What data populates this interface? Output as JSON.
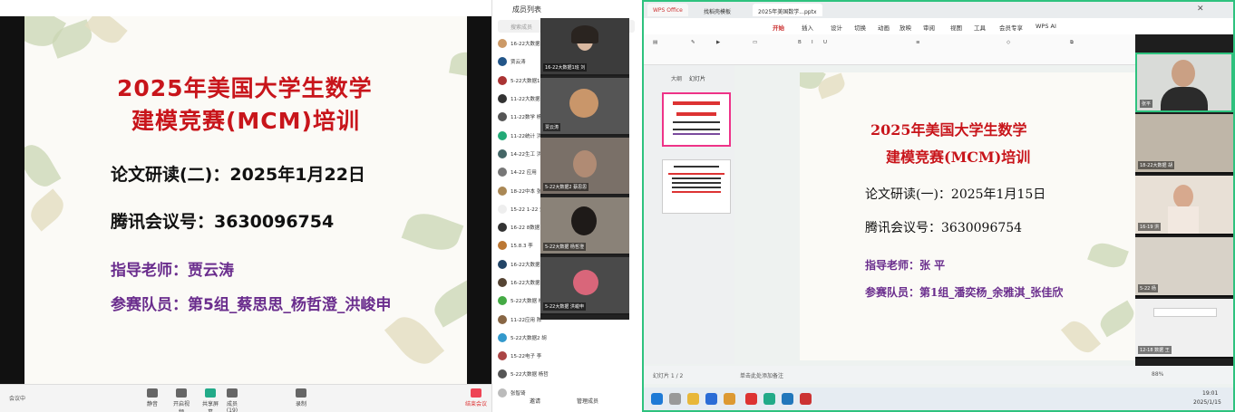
{
  "left_slide": {
    "title1": "2025年美国大学生数学",
    "title2": "建模竞赛(MCM)培训",
    "line1": "论文研读(二)：2025年1月22日",
    "line2": "腾讯会议号：3630096754",
    "line3": "指导老师：贾云涛",
    "line4": "参赛队员：第5组_蔡思思_杨哲澄_洪峻申"
  },
  "left_toolbar": {
    "mic_label": "静音",
    "video_label": "开启视频",
    "share_label": "共享屏幕",
    "members_label": "成员(19)",
    "record_label": "录制",
    "end_label": "结束会议",
    "left_status": "会议中"
  },
  "participants_panel": {
    "title": "成员列表",
    "search_placeholder": "搜索成员",
    "rows": [
      "16-22大数据1班 刘",
      "贾云涛",
      "5-22大数据1 蔡思思",
      "11-22大数据 杨",
      "11-22数学 杨",
      "11-22统计 洪",
      "14-22生工 洪峻申",
      "14-22 应用",
      "18-22中本 张",
      "15-22 1-22 刘",
      "16-22 8数据",
      "15.8.3 李",
      "16-22大数据 王",
      "16-22大数据 胡",
      "5-22大数据 杨",
      "11-22应用 陈",
      "5-22大数据2 胡",
      "15-22电子 李",
      "5-22大数据 杨哲",
      "张智琦"
    ],
    "video_names": [
      "16-22大数据1班 刘",
      "贾云涛",
      "5-22大数据2 蔡思思",
      "5-22大数据 杨哲澄",
      "5-22大数据 洪峻申"
    ],
    "footer_left": "邀请",
    "footer_right": "管理成员"
  },
  "right_window": {
    "tabs": [
      "WPS Office",
      "找稻壳模板",
      "2025年美国数学...pptx"
    ],
    "menus": [
      "开始",
      "插入",
      "设计",
      "切换",
      "动画",
      "放映",
      "审阅",
      "视图",
      "工具",
      "会员专享",
      "WPS AI"
    ],
    "thumb_tab1": "大纲",
    "thumb_tab2": "幻灯片",
    "status_left": "幻灯片 1 / 2",
    "status_mid": "单击此处添加备注",
    "status_right": "88%",
    "video_names": [
      "张平",
      "18-22大数据 胡",
      "16-19 洪",
      "5-22 杨",
      "12-18 数据 王"
    ],
    "time": "19:01",
    "date": "2025/1/15"
  },
  "right_slide": {
    "title1": "2025年美国大学生数学",
    "title2": "建模竞赛(MCM)培训",
    "line1": "论文研读(一)：2025年1月15日",
    "line2": "腾讯会议号：3630096754",
    "line3": "指导老师：张 平",
    "line4": "参赛队员：第1组_潘奕杨_余雅淇_张佳欣"
  }
}
